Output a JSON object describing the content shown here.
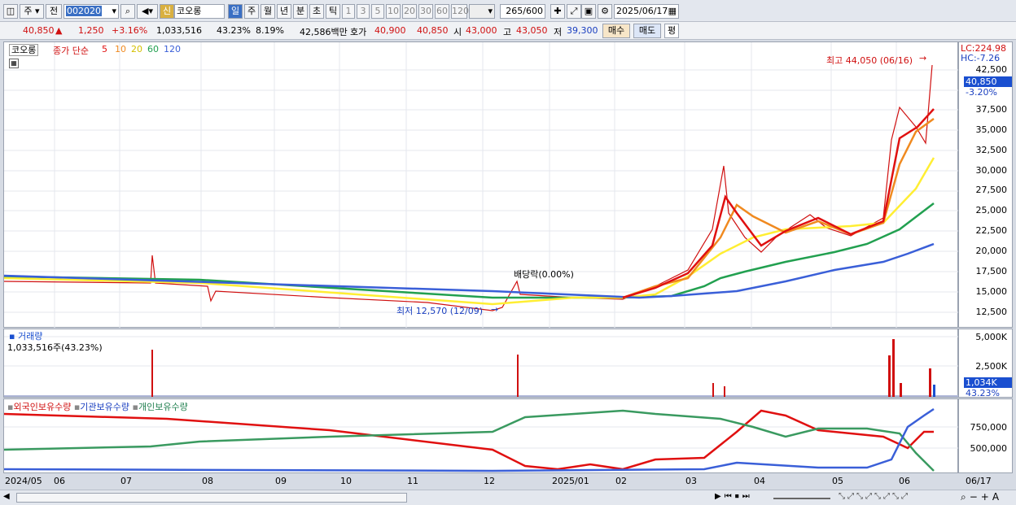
{
  "toolbar": {
    "type": "주",
    "prev": "전",
    "code": "002020",
    "new_badge": "신",
    "stock_name": "코오롱",
    "periods": [
      "일",
      "주",
      "월",
      "년",
      "분",
      "초",
      "틱"
    ],
    "minutes": [
      "1",
      "3",
      "5",
      "10",
      "20",
      "30",
      "60",
      "120"
    ],
    "count_value": "265",
    "count_max": "/600",
    "date": "2025/06/17"
  },
  "quote": {
    "price": "40,850",
    "change": "1,250",
    "change_pct": "+3.16%",
    "volume": "1,033,516",
    "turnover_pct": "43.23%",
    "ratio": "8.19%",
    "amount": "42,586백만",
    "bid_label": "호가",
    "ask": "40,900",
    "bid": "40,850",
    "open_label": "시",
    "open": "43,000",
    "high_label": "고",
    "high": "43,050",
    "low_label": "저",
    "low": "39,300",
    "buy": "매수",
    "sell": "매도",
    "avg": "평"
  },
  "price_panel": {
    "stock_tag": "코오롱",
    "ma_label": "종가 단순",
    "ma": [
      "5",
      "10",
      "20",
      "60",
      "120"
    ],
    "ma_colors": [
      "#e01010",
      "#f08a20",
      "#ffee33",
      "#22a050",
      "#3a5fd8"
    ],
    "high_note": "최고 44,050 (06/16)",
    "low_note": "최저 12,570 (12/09)",
    "dividend_note": "배당락(0.00%)",
    "lc": "LC:224.98",
    "hc": "HC:-7.26",
    "current": "40,850",
    "current_pct": "-3.20%",
    "yticks": [
      "42,500",
      "40,000",
      "37,500",
      "35,000",
      "32,500",
      "30,000",
      "27,500",
      "25,000",
      "22,500",
      "20,000",
      "17,500",
      "15,000",
      "12,500"
    ]
  },
  "volume_panel": {
    "title": "거래량",
    "value": "1,033,516주(43.23%)",
    "yticks": [
      "5,000K",
      "2,500K"
    ],
    "current": "1,034K",
    "current_pct": "43.23%"
  },
  "holders_panel": {
    "series": [
      "외국인보유수량",
      "기관보유수량",
      "개인보유수량"
    ],
    "yticks": [
      "750,000",
      "500,000"
    ]
  },
  "xaxis": [
    "2024/05",
    "06",
    "07",
    "08",
    "09",
    "10",
    "11",
    "12",
    "2025/01",
    "02",
    "03",
    "04",
    "05",
    "06",
    "06/17"
  ]
}
